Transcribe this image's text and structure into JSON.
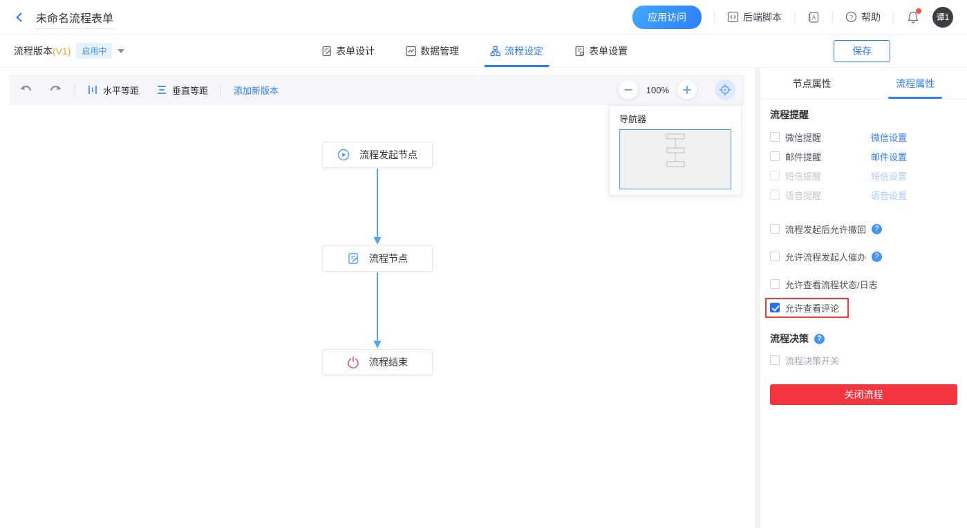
{
  "header": {
    "title": "未命名流程表单",
    "app_access": "应用访问",
    "backend_script": "后端脚本",
    "help": "帮助",
    "avatar": "谭1"
  },
  "subheader": {
    "version_label": "流程版本",
    "version_tag": "(V1)",
    "status_badge": "启用中",
    "tabs": [
      {
        "label": "表单设计"
      },
      {
        "label": "数据管理"
      },
      {
        "label": "流程设定"
      },
      {
        "label": "表单设置"
      }
    ],
    "save_label": "保存"
  },
  "canvas": {
    "toolbar": {
      "horizontal_spacing": "水平等距",
      "vertical_spacing": "垂直等距",
      "add_version": "添加新版本",
      "zoom_level": "100%",
      "zoom_out": "−",
      "zoom_in": "+"
    },
    "navigator": {
      "title": "导航器"
    },
    "nodes": [
      {
        "label": "流程发起节点",
        "icon": "play-circle"
      },
      {
        "label": "流程节点",
        "icon": "doc-edit"
      },
      {
        "label": "流程结束",
        "icon": "power"
      }
    ]
  },
  "sidebar": {
    "tabs": [
      {
        "label": "节点属性"
      },
      {
        "label": "流程属性"
      }
    ],
    "notify": {
      "title": "流程提醒",
      "rows": [
        {
          "label": "微信提醒",
          "link": "微信设置",
          "checked": false,
          "disabled": false
        },
        {
          "label": "邮件提醒",
          "link": "邮件设置",
          "checked": false,
          "disabled": false
        },
        {
          "label": "短信提醒",
          "link": "短信设置",
          "checked": false,
          "disabled": true
        },
        {
          "label": "语音提醒",
          "link": "语音设置",
          "checked": false,
          "disabled": true
        }
      ]
    },
    "options": [
      {
        "label": "流程发起后允许撤回",
        "checked": false,
        "help": true
      },
      {
        "label": "允许流程发起人催办",
        "checked": false,
        "help": true
      },
      {
        "label": "允许查看流程状态/日志",
        "checked": false,
        "help": false
      },
      {
        "label": "允许查看评论",
        "checked": true,
        "help": false,
        "highlighted": true
      }
    ],
    "decision": {
      "title": "流程决策",
      "toggle_label": "流程决策开关"
    },
    "close_button": "关闭流程"
  },
  "colors": {
    "primary_blue": "#2e7cf6",
    "arrow_blue": "#54a4f6",
    "badge_bg": "#e6f2ff",
    "version_orange": "#f7a523",
    "danger_red": "#f2353e",
    "highlight_red": "#e23b3b",
    "node_end_red": "#d9565e"
  }
}
